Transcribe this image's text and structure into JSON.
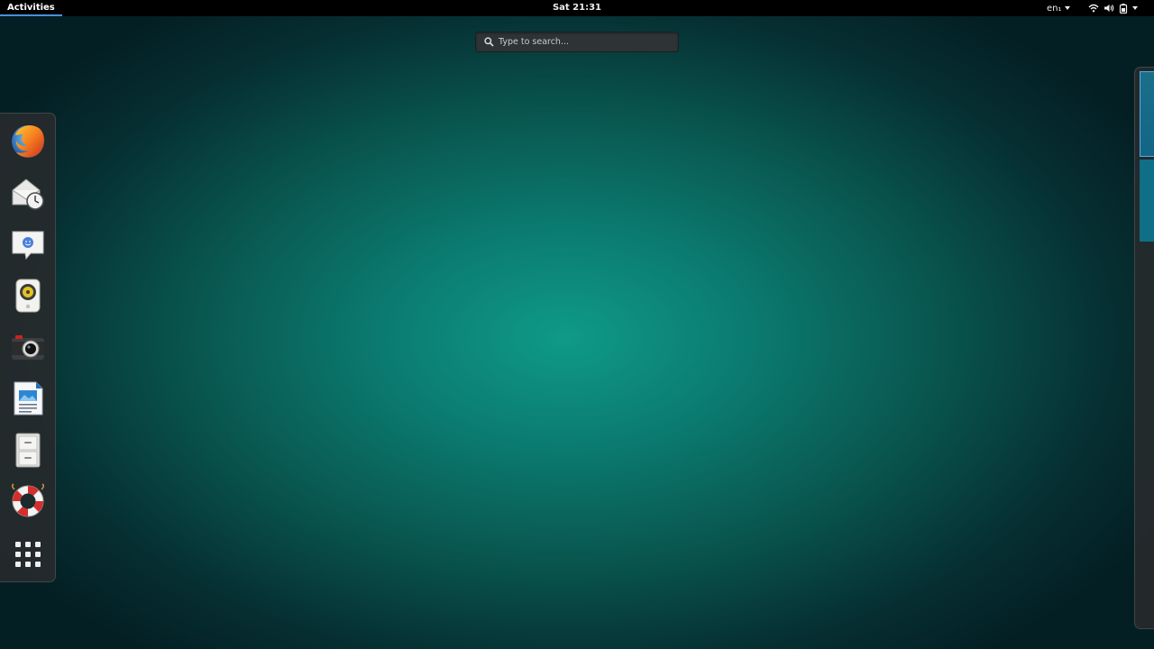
{
  "topbar": {
    "activities_label": "Activities",
    "clock": "Sat 21:31",
    "language": "en₁"
  },
  "search": {
    "placeholder": "Type to search..."
  },
  "dash": {
    "apps": [
      {
        "name": "firefox",
        "icon": "firefox-icon"
      },
      {
        "name": "evolution",
        "icon": "mail-clock-icon"
      },
      {
        "name": "empathy",
        "icon": "chat-icon"
      },
      {
        "name": "rhythmbox",
        "icon": "speaker-icon"
      },
      {
        "name": "cheese",
        "icon": "camera-icon"
      },
      {
        "name": "libreoffice-writer",
        "icon": "document-icon"
      },
      {
        "name": "files",
        "icon": "file-cabinet-icon"
      },
      {
        "name": "help",
        "icon": "lifebuoy-icon"
      },
      {
        "name": "show-applications",
        "icon": "grid-icon"
      }
    ]
  },
  "colors": {
    "accent": "#4a90d9",
    "topbar": "#000000",
    "background_center": "#0f9a88",
    "background_edge": "#041f24"
  }
}
